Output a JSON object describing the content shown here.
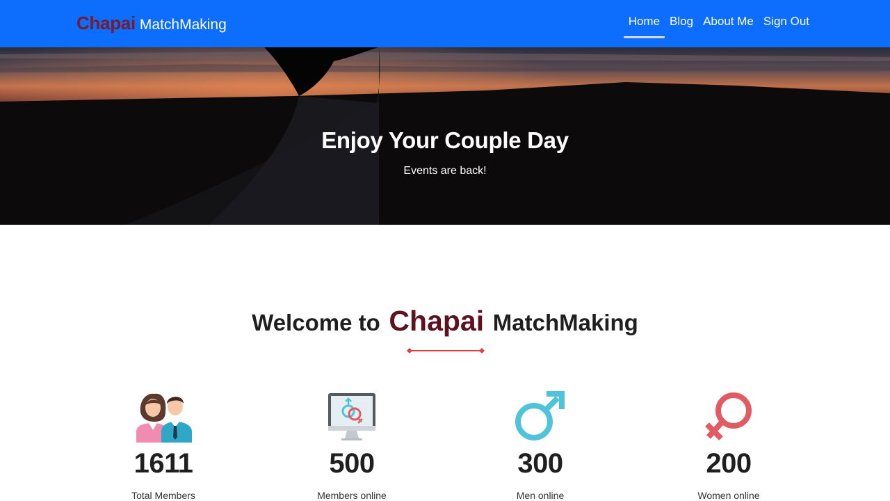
{
  "brand": {
    "accent": "Chapai",
    "rest": "MatchMaking"
  },
  "nav": {
    "items": [
      {
        "label": "Home",
        "active": true
      },
      {
        "label": "Blog",
        "active": false
      },
      {
        "label": "About Me",
        "active": false
      },
      {
        "label": "Sign Out",
        "active": false
      }
    ]
  },
  "hero": {
    "title": "Enjoy Your Couple Day",
    "subtitle": "Events are back!"
  },
  "welcome": {
    "prefix": "Welcome to",
    "accent": "Chapai",
    "suffix": "MatchMaking"
  },
  "stats": [
    {
      "value": "1611",
      "label": "Total Members",
      "icon": "couple-icon"
    },
    {
      "value": "500",
      "label": "Members online",
      "icon": "monitor-gender-icon"
    },
    {
      "value": "300",
      "label": "Men online",
      "icon": "male-symbol-icon"
    },
    {
      "value": "200",
      "label": "Women online",
      "icon": "female-symbol-icon"
    }
  ],
  "colors": {
    "navbar": "#0d6efd",
    "brand_accent": "#7a1a2e",
    "welcome_accent": "#5e1220",
    "divider": "#e0403a",
    "male": "#4fc3d9",
    "female": "#e25b63"
  }
}
